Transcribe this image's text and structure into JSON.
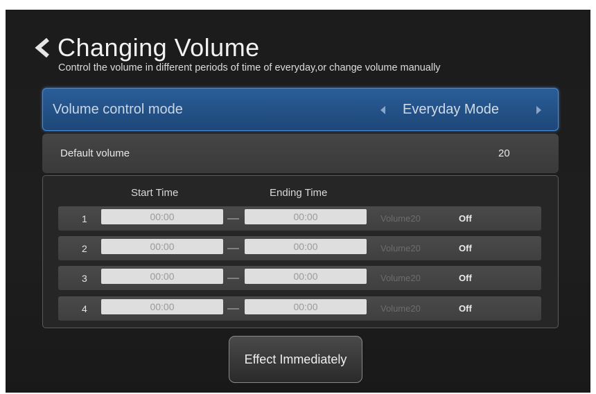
{
  "header": {
    "back_icon": "chevron-left-icon",
    "title": "Changing Volume",
    "subtitle": "Control the volume in different periods of time of everyday,or change volume manually"
  },
  "mode": {
    "label": "Volume control mode",
    "value": "Everyday Mode",
    "prev_icon": "triangle-left-icon",
    "next_icon": "triangle-right-icon"
  },
  "default_volume": {
    "label": "Default volume",
    "value": "20"
  },
  "schedule": {
    "columns": {
      "start": "Start Time",
      "end": "Ending Time"
    },
    "rows": [
      {
        "num": "1",
        "start": "00:00",
        "end": "00:00",
        "volume": "Volume20",
        "state": "Off"
      },
      {
        "num": "2",
        "start": "00:00",
        "end": "00:00",
        "volume": "Volume20",
        "state": "Off"
      },
      {
        "num": "3",
        "start": "00:00",
        "end": "00:00",
        "volume": "Volume20",
        "state": "Off"
      },
      {
        "num": "4",
        "start": "00:00",
        "end": "00:00",
        "volume": "Volume20",
        "state": "Off"
      }
    ]
  },
  "actions": {
    "effect_label": "Effect Immediately"
  },
  "colors": {
    "accent": "#2a5d98",
    "background": "#1c1c1c",
    "panel": "#454545"
  }
}
